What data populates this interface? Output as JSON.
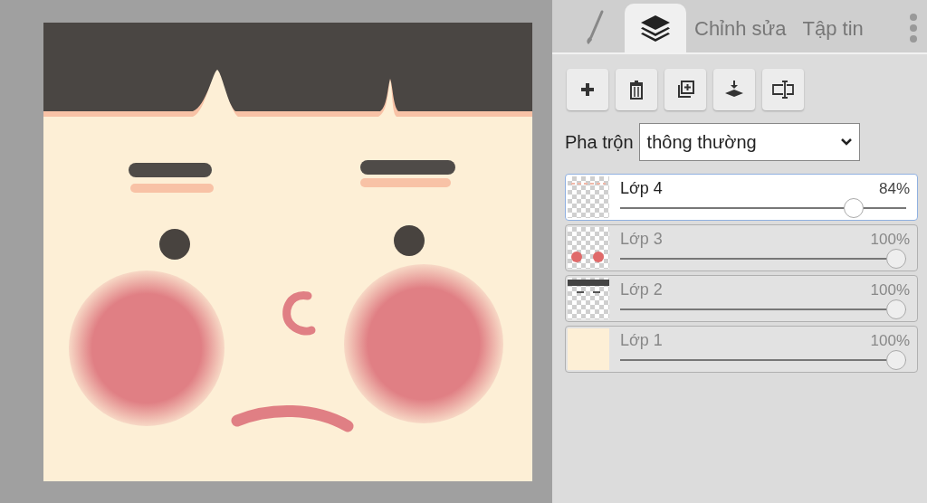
{
  "tabs": [
    {
      "kind": "brush",
      "selected": false
    },
    {
      "kind": "layers",
      "selected": true
    },
    {
      "kind": "text",
      "label": "Chỉnh sửa",
      "selected": false
    },
    {
      "kind": "text",
      "label": "Tập tin",
      "selected": false
    }
  ],
  "toolbar": [
    {
      "kind": "add"
    },
    {
      "kind": "delete"
    },
    {
      "kind": "duplicate"
    },
    {
      "kind": "merge"
    },
    {
      "kind": "rename"
    }
  ],
  "blend": {
    "label": "Pha trộn",
    "value": "thông thường"
  },
  "layers": [
    {
      "name": "Lớp 4",
      "opacity": "84%",
      "level": 0.84,
      "selected": true
    },
    {
      "name": "Lớp 3",
      "opacity": "100%",
      "level": 1,
      "selected": false
    },
    {
      "name": "Lớp 2",
      "opacity": "100%",
      "level": 1,
      "selected": false
    },
    {
      "name": "Lớp 1",
      "opacity": "100%",
      "level": 1,
      "selected": false
    }
  ]
}
